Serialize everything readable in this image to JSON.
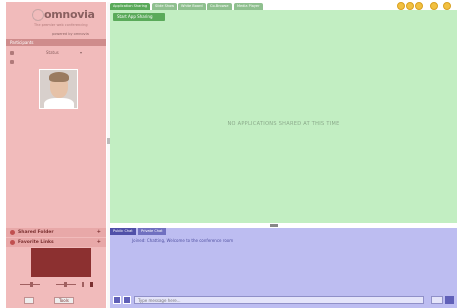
{
  "app": {
    "logo_text": "omnovia",
    "tagline": "The premier web conferencing",
    "powered_by": "powered by omnovia"
  },
  "left_panel": {
    "participants_header": "Participants",
    "participant": {
      "name": "",
      "status": "Status",
      "caret": "▾"
    },
    "shared_folder_label": "Shared Folder",
    "favorite_links_label": "Favorite Links",
    "add_glyph": "+",
    "tools": {
      "tool_button": "Tools"
    }
  },
  "tabs": [
    {
      "label": "Application Sharing",
      "active": true
    },
    {
      "label": "Slide Show",
      "active": false
    },
    {
      "label": "White Board",
      "active": false
    },
    {
      "label": "Co-Browse",
      "active": false
    },
    {
      "label": "Media Player",
      "active": false
    }
  ],
  "window_controls": [
    "help-icon",
    "settings-icon",
    "info-icon",
    "minimize-icon",
    "close-icon"
  ],
  "main": {
    "start_button": "Start App Sharing",
    "empty_message": "NO APPLICATIONS SHARED AT THIS TIME"
  },
  "chat": {
    "tabs": [
      {
        "label": "Public Chat",
        "active": true
      },
      {
        "label": "Private Chat",
        "active": false
      }
    ],
    "messages": [
      "Joined: Chatting, Welcome to the conference room"
    ],
    "input_placeholder": "Type message here..."
  },
  "colors": {
    "left_panel": "#f4c4c4",
    "main_area": "#c8f2c8",
    "chat_area": "#c4c4f4",
    "accent_green": "#5aaa5a"
  }
}
